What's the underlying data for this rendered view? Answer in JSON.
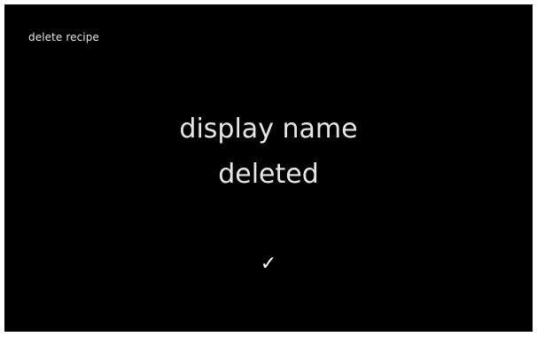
{
  "screen": {
    "title": "delete recipe",
    "message_line_1": "display name",
    "message_line_2": "deleted",
    "confirm_icon": "check-icon",
    "confirm_glyph": "✓",
    "background_color": "#000000",
    "text_color": "#e6e6e6"
  }
}
